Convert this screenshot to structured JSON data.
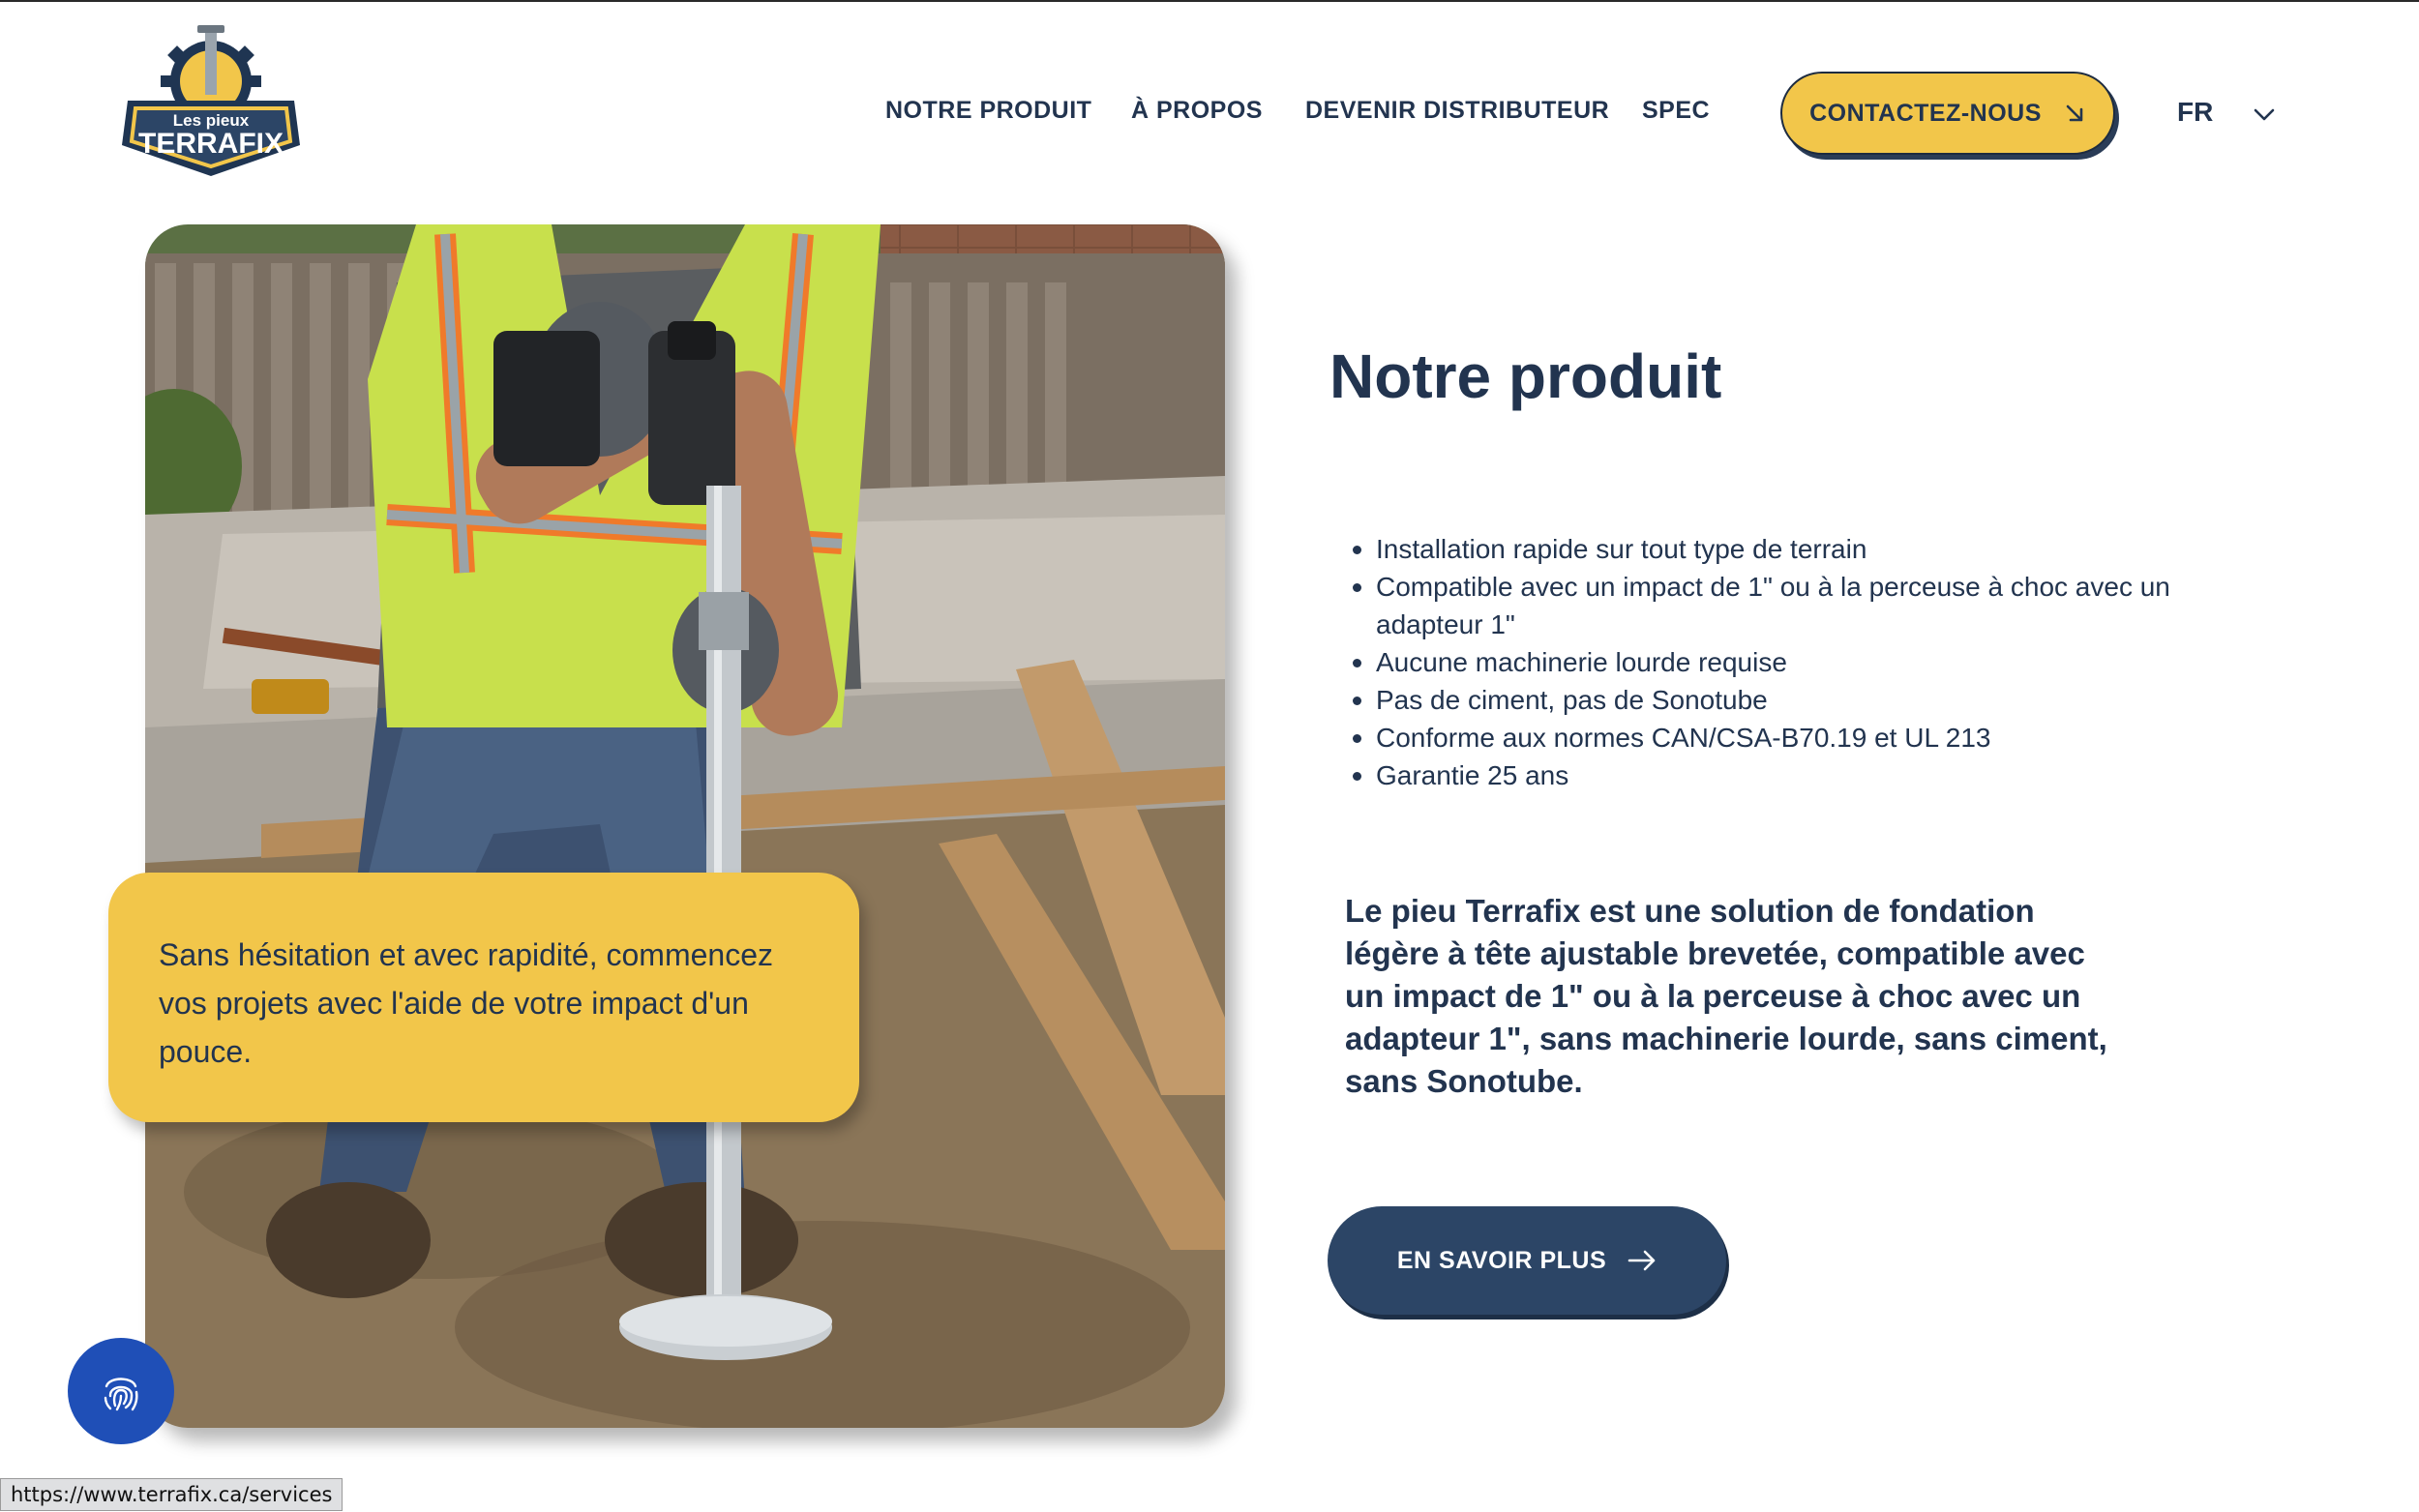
{
  "brand": {
    "logo_small": "Les pieux",
    "logo_big": "TERRAFIX"
  },
  "nav": {
    "items": [
      {
        "label": "NOTRE PRODUIT"
      },
      {
        "label": "À PROPOS"
      },
      {
        "label": "DEVENIR DISTRIBUTEUR"
      },
      {
        "label": "SPEC"
      }
    ],
    "contact_label": "CONTACTEZ-NOUS",
    "language": "FR"
  },
  "hero": {
    "quote": "Sans hésitation et avec rapidité, commencez vos projets avec l'aide de votre impact d'un pouce."
  },
  "product": {
    "title": "Notre produit",
    "features": [
      "Installation rapide sur tout type de terrain",
      "Compatible avec un impact de 1\" ou à la perceuse à choc avec un adapteur 1\"",
      "Aucune machinerie lourde requise",
      "Pas de ciment, pas de Sonotube",
      "Conforme aux normes CAN/CSA-B70.19 et UL 213",
      "Garantie 25 ans"
    ],
    "description": "Le pieu Terrafix est une solution de fondation légère à tête ajustable brevetée, compatible avec un impact de 1\" ou à la perceuse à choc avec un adapteur 1\", sans machinerie lourde, sans ciment, sans Sonotube.",
    "cta_label": "EN SAVOIR PLUS"
  },
  "status_bar": {
    "url": "https://www.terrafix.ca/services"
  },
  "colors": {
    "navy": "#22344f",
    "yellow": "#f2c64a",
    "button_navy": "#2c4566",
    "accessibility_blue": "#1f4fb7"
  },
  "icons": {
    "contact": "arrow-down-right-icon",
    "language": "chevron-down-icon",
    "cta": "arrow-right-icon",
    "accessibility": "fingerprint-icon"
  }
}
